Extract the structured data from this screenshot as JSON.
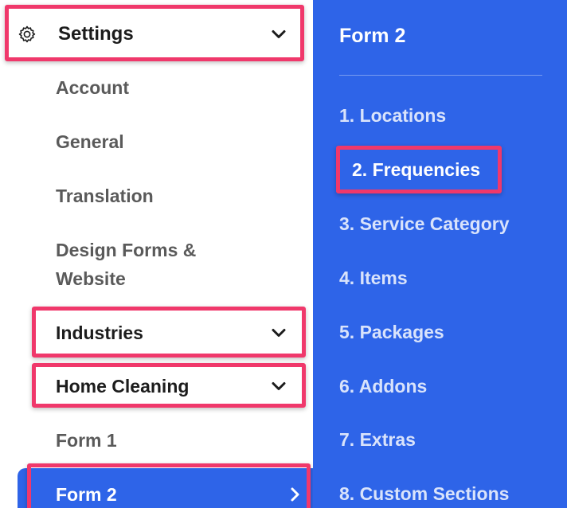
{
  "sidebar": {
    "settings": {
      "label": "Settings",
      "icon": "gear-icon",
      "expanded_icon": "chevron-down-icon"
    },
    "items": {
      "account": "Account",
      "general": "General",
      "translation": "Translation",
      "design_line1": "Design Forms &",
      "design_line2": "Website",
      "industries": "Industries",
      "home_cleaning": "Home Cleaning",
      "form1": "Form 1",
      "form2": "Form 2"
    },
    "active_item_icon": "chevron-right-icon"
  },
  "panel": {
    "title": "Form 2",
    "steps": [
      "1. Locations",
      "2. Frequencies",
      "3. Service Category",
      "4. Items",
      "5. Packages",
      "6. Addons",
      "7. Extras",
      "8. Custom Sections"
    ],
    "active_step_index": 1
  },
  "colors": {
    "accent": "#2e64e8",
    "highlight": "#f0386b",
    "muted_text": "#5a5a5a",
    "strong_text": "#1c1c1c"
  }
}
